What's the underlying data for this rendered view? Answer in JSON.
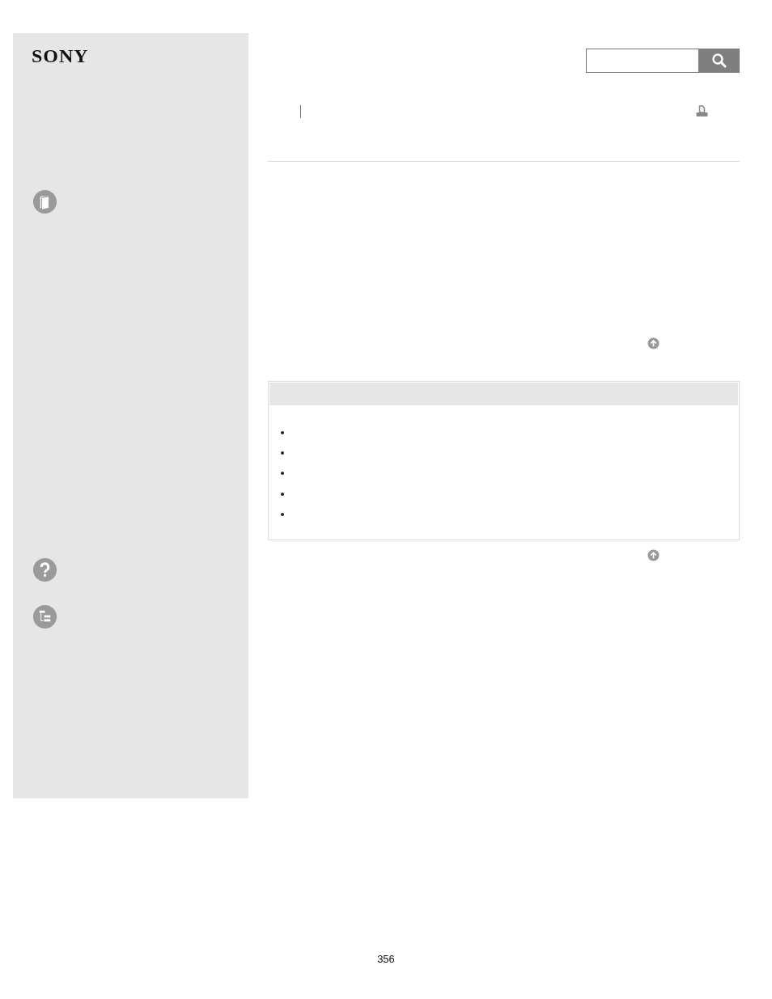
{
  "sidebar": {
    "logo": "SONY"
  },
  "page_number": "356"
}
